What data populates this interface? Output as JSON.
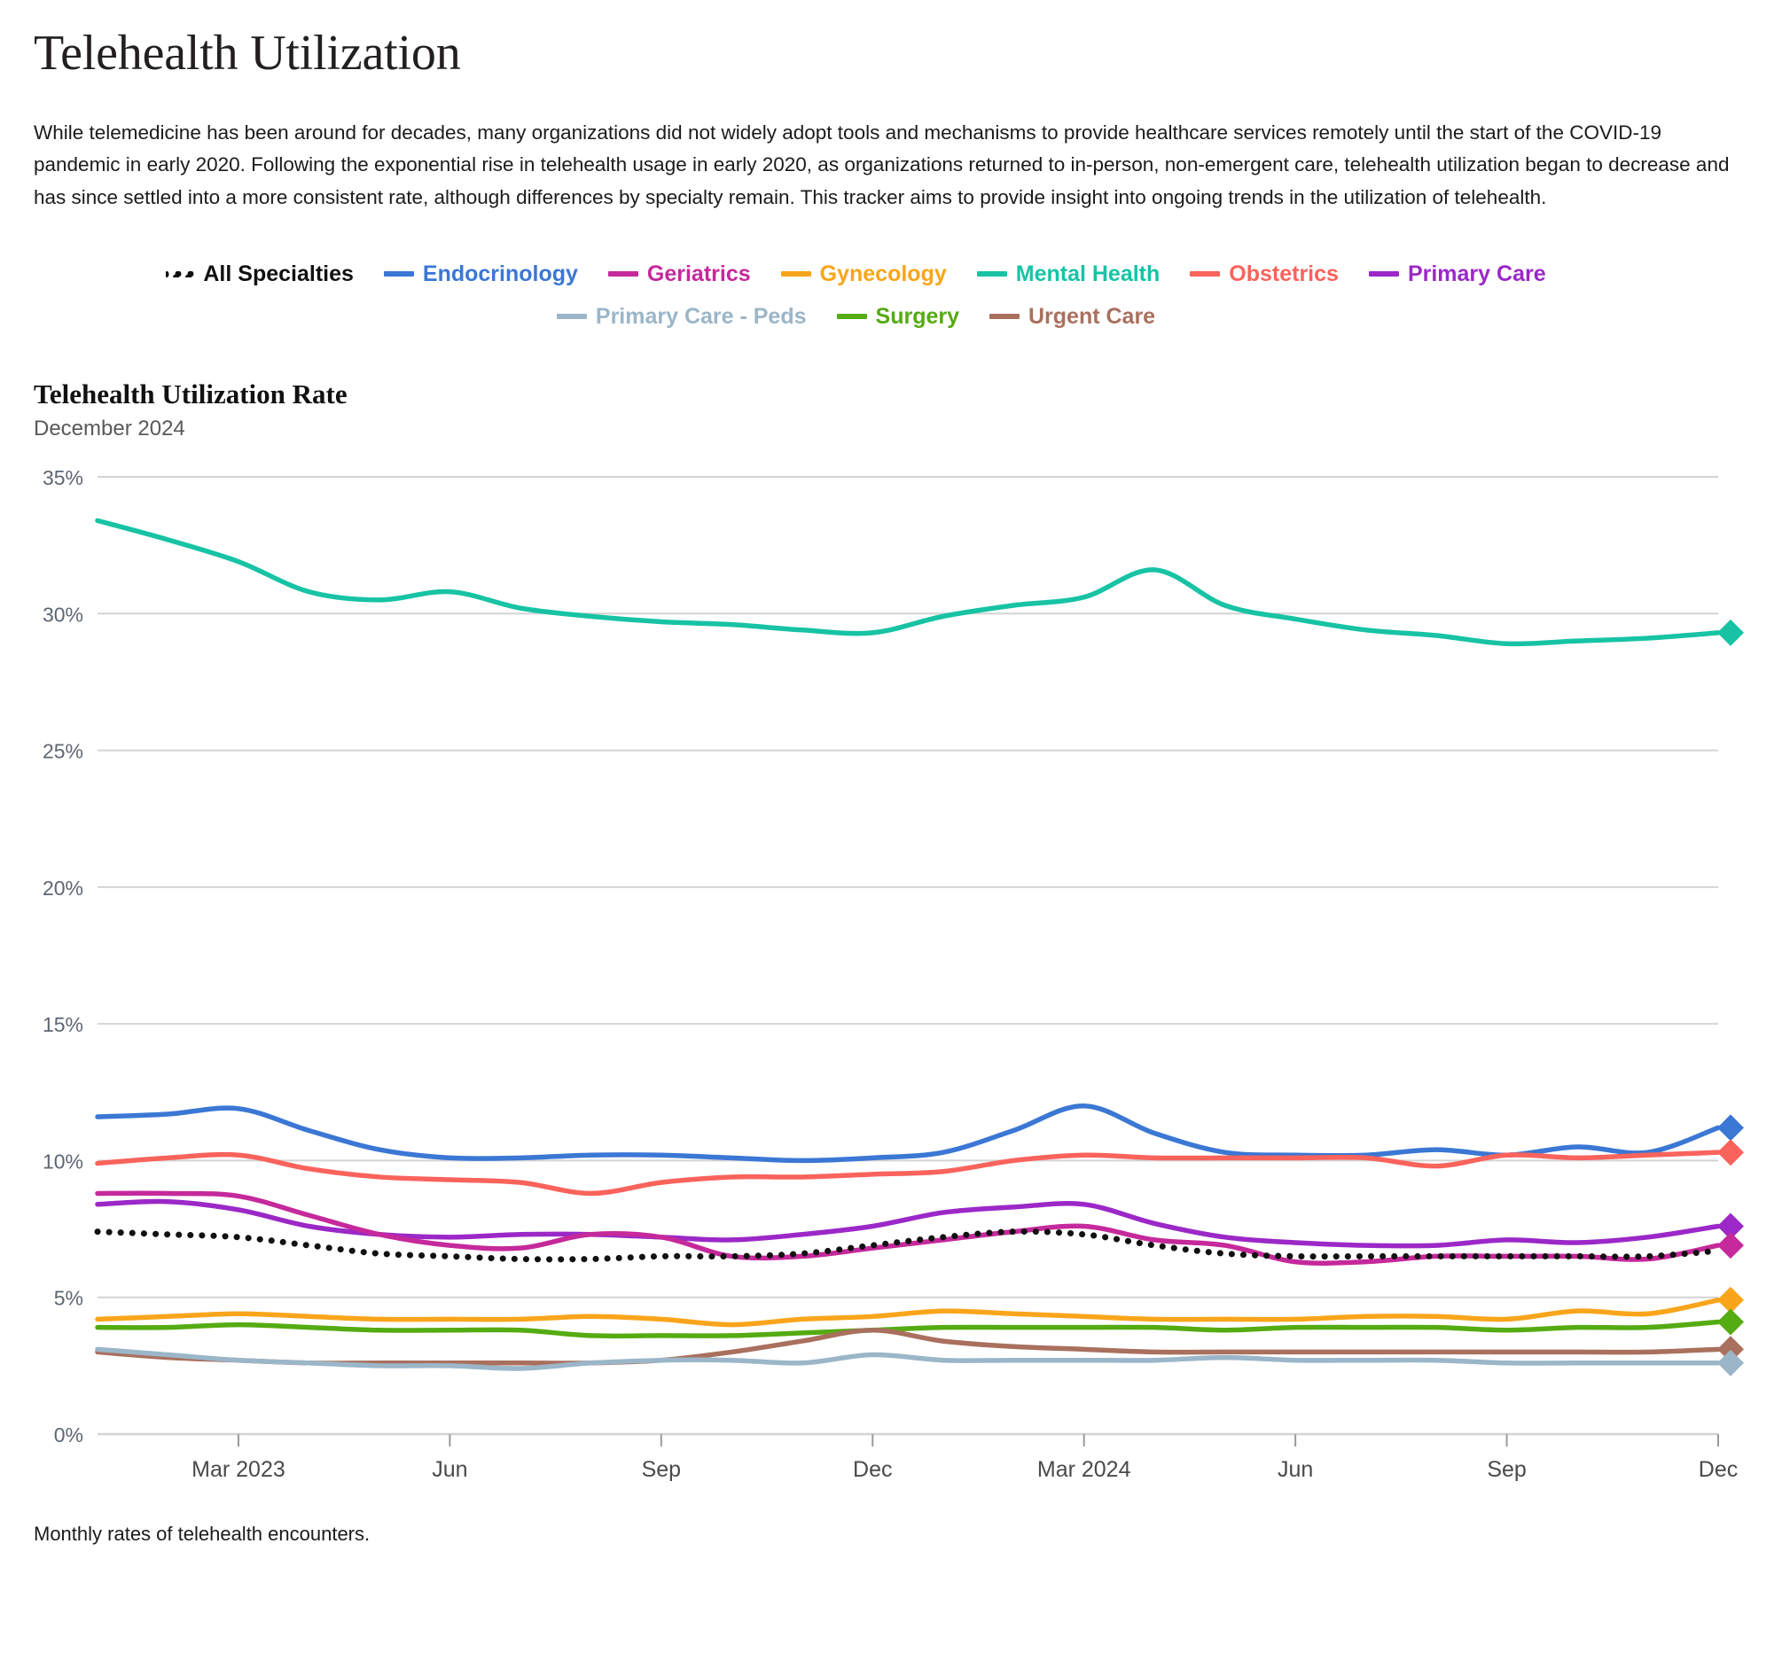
{
  "page": {
    "title": "Telehealth Utilization",
    "intro": "While telemedicine has been around for decades, many organizations did not widely adopt tools and mechanisms to provide healthcare services remotely until the start of the COVID-19 pandemic in early 2020. Following the exponential rise in telehealth usage in early 2020, as organizations returned to in-person, non-emergent care, telehealth utilization began to decrease and has since settled into a more consistent rate, although differences by specialty remain. This tracker aims to provide insight into ongoing trends in the utilization of telehealth.",
    "footnote": "Monthly rates of telehealth encounters."
  },
  "legend": {
    "items": [
      {
        "label": "All Specialties",
        "color": "#111111",
        "style": "dotted"
      },
      {
        "label": "Endocrinology",
        "color": "#3b77d4",
        "style": "solid"
      },
      {
        "label": "Geriatrics",
        "color": "#c5299b",
        "style": "solid"
      },
      {
        "label": "Gynecology",
        "color": "#f9a51b",
        "style": "solid"
      },
      {
        "label": "Mental Health",
        "color": "#17c3a4",
        "style": "solid"
      },
      {
        "label": "Obstetrics",
        "color": "#f9635c",
        "style": "solid"
      },
      {
        "label": "Primary Care",
        "color": "#9b28c7",
        "style": "solid"
      },
      {
        "label": "Primary Care - Peds",
        "color": "#9bb6c9",
        "style": "solid"
      },
      {
        "label": "Surgery",
        "color": "#55ab12",
        "style": "solid"
      },
      {
        "label": "Urgent Care",
        "color": "#a9705e",
        "style": "solid"
      }
    ]
  },
  "chart_header": {
    "title": "Telehealth Utilization Rate",
    "subtitle": "December 2024"
  },
  "chart_data": {
    "type": "line",
    "title": "Telehealth Utilization Rate",
    "subtitle": "December 2024",
    "xlabel": "",
    "ylabel": "",
    "ylim": [
      0,
      35
    ],
    "y_ticks": [
      0,
      5,
      10,
      15,
      20,
      25,
      30,
      35
    ],
    "y_tick_labels": [
      "0%",
      "5%",
      "10%",
      "15%",
      "20%",
      "25%",
      "30%",
      "35%"
    ],
    "grid": "horizontal",
    "legend_position": "top-center",
    "end_markers": "diamond",
    "x": [
      "Jan 2023",
      "Feb 2023",
      "Mar 2023",
      "Apr 2023",
      "May 2023",
      "Jun 2023",
      "Jul 2023",
      "Aug 2023",
      "Sep 2023",
      "Oct 2023",
      "Nov 2023",
      "Dec 2023",
      "Jan 2024",
      "Feb 2024",
      "Mar 2024",
      "Apr 2024",
      "May 2024",
      "Jun 2024",
      "Jul 2024",
      "Aug 2024",
      "Sep 2024",
      "Oct 2024",
      "Nov 2024",
      "Dec 2024"
    ],
    "x_tick_labels": [
      "Mar 2023",
      "Jun",
      "Sep",
      "Dec",
      "Mar 2024",
      "Jun",
      "Sep",
      "Dec"
    ],
    "x_tick_indices": [
      2,
      5,
      8,
      11,
      14,
      17,
      20,
      23
    ],
    "series": [
      {
        "name": "Mental Health",
        "color": "#17c3a4",
        "style": "solid",
        "values": [
          33.4,
          32.7,
          31.9,
          30.8,
          30.5,
          30.8,
          30.2,
          29.9,
          29.7,
          29.6,
          29.4,
          29.3,
          29.9,
          30.3,
          30.6,
          31.6,
          30.3,
          29.8,
          29.4,
          29.2,
          28.9,
          29.0,
          29.1,
          29.3
        ]
      },
      {
        "name": "Endocrinology",
        "color": "#3b77d4",
        "style": "solid",
        "values": [
          11.6,
          11.7,
          11.9,
          11.1,
          10.4,
          10.1,
          10.1,
          10.2,
          10.2,
          10.1,
          10.0,
          10.1,
          10.3,
          11.1,
          12.0,
          11.0,
          10.3,
          10.2,
          10.2,
          10.4,
          10.2,
          10.5,
          10.3,
          11.2
        ]
      },
      {
        "name": "Obstetrics",
        "color": "#f9635c",
        "style": "solid",
        "values": [
          9.9,
          10.1,
          10.2,
          9.7,
          9.4,
          9.3,
          9.2,
          8.8,
          9.2,
          9.4,
          9.4,
          9.5,
          9.6,
          10.0,
          10.2,
          10.1,
          10.1,
          10.1,
          10.1,
          9.8,
          10.2,
          10.1,
          10.2,
          10.3
        ]
      },
      {
        "name": "Primary Care",
        "color": "#9b28c7",
        "style": "solid",
        "values": [
          8.4,
          8.5,
          8.2,
          7.6,
          7.3,
          7.2,
          7.3,
          7.3,
          7.2,
          7.1,
          7.3,
          7.6,
          8.1,
          8.3,
          8.4,
          7.7,
          7.2,
          7.0,
          6.9,
          6.9,
          7.1,
          7.0,
          7.2,
          7.6
        ]
      },
      {
        "name": "Geriatrics",
        "color": "#c5299b",
        "style": "solid",
        "values": [
          8.8,
          8.8,
          8.7,
          8.0,
          7.3,
          6.9,
          6.8,
          7.3,
          7.2,
          6.5,
          6.5,
          6.8,
          7.1,
          7.4,
          7.6,
          7.1,
          6.9,
          6.3,
          6.3,
          6.5,
          6.5,
          6.5,
          6.4,
          6.9
        ]
      },
      {
        "name": "All Specialties",
        "color": "#111111",
        "style": "dotted",
        "values": [
          7.4,
          7.3,
          7.2,
          6.9,
          6.6,
          6.5,
          6.4,
          6.4,
          6.5,
          6.5,
          6.6,
          6.9,
          7.2,
          7.4,
          7.3,
          6.9,
          6.6,
          6.5,
          6.5,
          6.5,
          6.5,
          6.5,
          6.5,
          6.7
        ]
      },
      {
        "name": "Gynecology",
        "color": "#f9a51b",
        "style": "solid",
        "values": [
          4.2,
          4.3,
          4.4,
          4.3,
          4.2,
          4.2,
          4.2,
          4.3,
          4.2,
          4.0,
          4.2,
          4.3,
          4.5,
          4.4,
          4.3,
          4.2,
          4.2,
          4.2,
          4.3,
          4.3,
          4.2,
          4.5,
          4.4,
          4.9
        ]
      },
      {
        "name": "Surgery",
        "color": "#55ab12",
        "style": "solid",
        "values": [
          3.9,
          3.9,
          4.0,
          3.9,
          3.8,
          3.8,
          3.8,
          3.6,
          3.6,
          3.6,
          3.7,
          3.8,
          3.9,
          3.9,
          3.9,
          3.9,
          3.8,
          3.9,
          3.9,
          3.9,
          3.8,
          3.9,
          3.9,
          4.1
        ]
      },
      {
        "name": "Urgent Care",
        "color": "#a9705e",
        "style": "solid",
        "values": [
          3.0,
          2.8,
          2.7,
          2.6,
          2.6,
          2.6,
          2.6,
          2.6,
          2.7,
          3.0,
          3.4,
          3.8,
          3.4,
          3.2,
          3.1,
          3.0,
          3.0,
          3.0,
          3.0,
          3.0,
          3.0,
          3.0,
          3.0,
          3.1
        ]
      },
      {
        "name": "Primary Care - Peds",
        "color": "#9bb6c9",
        "style": "solid",
        "values": [
          3.1,
          2.9,
          2.7,
          2.6,
          2.5,
          2.5,
          2.4,
          2.6,
          2.7,
          2.7,
          2.6,
          2.9,
          2.7,
          2.7,
          2.7,
          2.7,
          2.8,
          2.7,
          2.7,
          2.7,
          2.6,
          2.6,
          2.6,
          2.6
        ]
      }
    ]
  }
}
